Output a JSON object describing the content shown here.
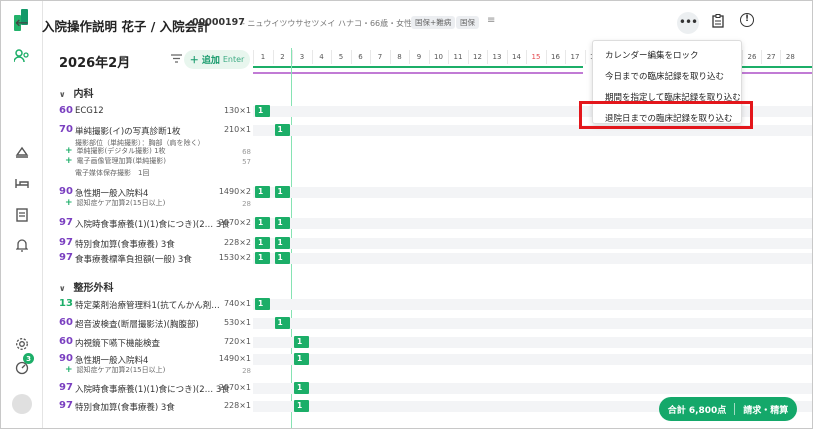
{
  "header": {
    "title": "入院操作説明 花子 / 入院会計",
    "patient_id": "00000197",
    "patient_info": "- ニュウイツウサセツメイ ハナコ・66歳・女性",
    "tags": [
      "国保+難病",
      "国保"
    ]
  },
  "toolbar": {
    "month": "2026年2月",
    "add_label": "＋ 追加",
    "add_hint": "Enter"
  },
  "calendar": {
    "days": [
      "1",
      "2",
      "3",
      "4",
      "5",
      "6",
      "7",
      "8",
      "9",
      "10",
      "11",
      "12",
      "13",
      "14",
      "15",
      "16",
      "17",
      "18",
      "26",
      "27",
      "28"
    ],
    "today_index": 2
  },
  "menu": {
    "items": [
      "カレンダー編集をロック",
      "今日までの臨床記録を取り込む",
      "期間を指定して臨床記録を取り込む",
      "退院日までの臨床記録を取り込む"
    ],
    "highlighted_index": 3
  },
  "sections": [
    {
      "title": "内科",
      "rows": [
        {
          "points": "60",
          "name": "ECG12",
          "qty": "130×1",
          "cells": [
            "1"
          ],
          "cell_day": 1
        },
        {
          "points": "70",
          "name": "単純撮影(イ)の写真診断1枚",
          "qty": "210×1",
          "cells": [
            "1"
          ],
          "cell_day": 2,
          "details": [
            "撮影部位（単純撮影）：胸部（肩を除く）"
          ],
          "subs": [
            {
              "name": "単純撮影(デジタル撮影) 1枚",
              "qty": "68"
            },
            {
              "name": "電子画像管理加算(単純撮影)",
              "qty": "57"
            }
          ],
          "note": "電子媒体保存撮影　1回"
        },
        {
          "points": "90",
          "name": "急性期一般入院料4",
          "qty": "1490×2",
          "cells": [
            "1",
            "1"
          ],
          "cell_day": 1,
          "subs": [
            {
              "name": "認知症ケア加算2(15日以上)",
              "qty": "28"
            }
          ]
        },
        {
          "points": "97",
          "name": "入院時食事療養(1)(1)食につき)(2… 3食",
          "qty": "2070×2",
          "cells": [
            "1",
            "1"
          ],
          "cell_day": 1
        },
        {
          "points": "97",
          "name": "特別食加算(食事療養) 3食",
          "qty": "228×2",
          "cells": [
            "1",
            "1"
          ],
          "cell_day": 1
        },
        {
          "points": "97",
          "name": "食事療養標準負担額(一般) 3食",
          "qty": "1530×2",
          "cells": [
            "1",
            "1"
          ],
          "cell_day": 1
        }
      ]
    },
    {
      "title": "整形外科",
      "rows": [
        {
          "points": "13",
          "name": "特定薬剤治療管理料1(抗てんかん剤…",
          "qty": "740×1",
          "cells": [
            "1"
          ],
          "cell_day": 1
        },
        {
          "points": "60",
          "name": "超音波検査(断層撮影法)(胸腹部)",
          "qty": "530×1",
          "cells": [
            "1"
          ],
          "cell_day": 2
        },
        {
          "points": "60",
          "name": "内視鏡下嚥下機能検査",
          "qty": "720×1",
          "cells": [
            "1"
          ],
          "cell_day": 3
        },
        {
          "points": "90",
          "name": "急性期一般入院料4",
          "qty": "1490×1",
          "cells": [
            "1"
          ],
          "cell_day": 3,
          "subs": [
            {
              "name": "認知症ケア加算2(15日以上)",
              "qty": "28"
            }
          ]
        },
        {
          "points": "97",
          "name": "入院時食事療養(1)(1)食につき)(2… 3食",
          "qty": "2070×1",
          "cells": [
            "1"
          ],
          "cell_day": 3
        },
        {
          "points": "97",
          "name": "特別食加算(食事療養) 3食",
          "qty": "228×1",
          "cells": [
            "1"
          ],
          "cell_day": 3
        }
      ]
    }
  ],
  "footer": {
    "total_label": "合計 6,800点",
    "bill_label": "請求・精算"
  },
  "sidebar": {
    "badge": "3"
  },
  "colors": {
    "accent": "#1cae68",
    "points_purple": "#7a3fc0",
    "highlight_red": "#e3161b"
  }
}
